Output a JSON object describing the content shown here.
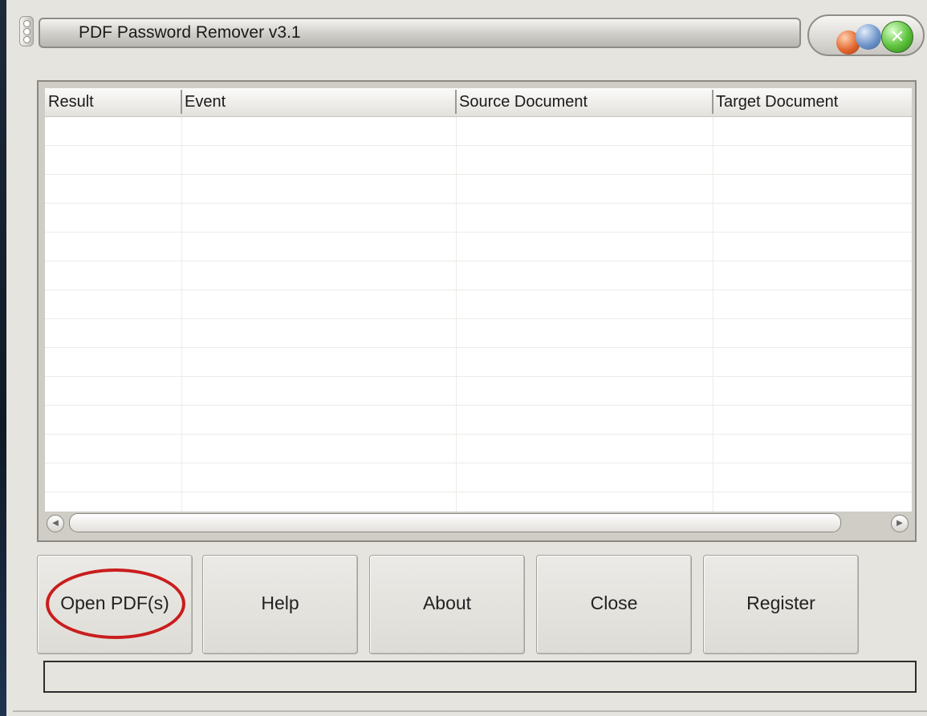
{
  "window": {
    "title": "PDF Password Remover v3.1",
    "close_glyph": "✕"
  },
  "table": {
    "columns": [
      "Result",
      "Event",
      "Source Document",
      "Target Document"
    ],
    "rows": []
  },
  "scrollbar": {
    "left_glyph": "◀",
    "right_glyph": "▶"
  },
  "buttons": {
    "open": "Open PDF(s)",
    "help": "Help",
    "about": "About",
    "close": "Close",
    "register": "Register"
  },
  "status": {
    "text": ""
  },
  "colors": {
    "highlight": "#c91d1d",
    "close_button": "#5cc13b"
  }
}
